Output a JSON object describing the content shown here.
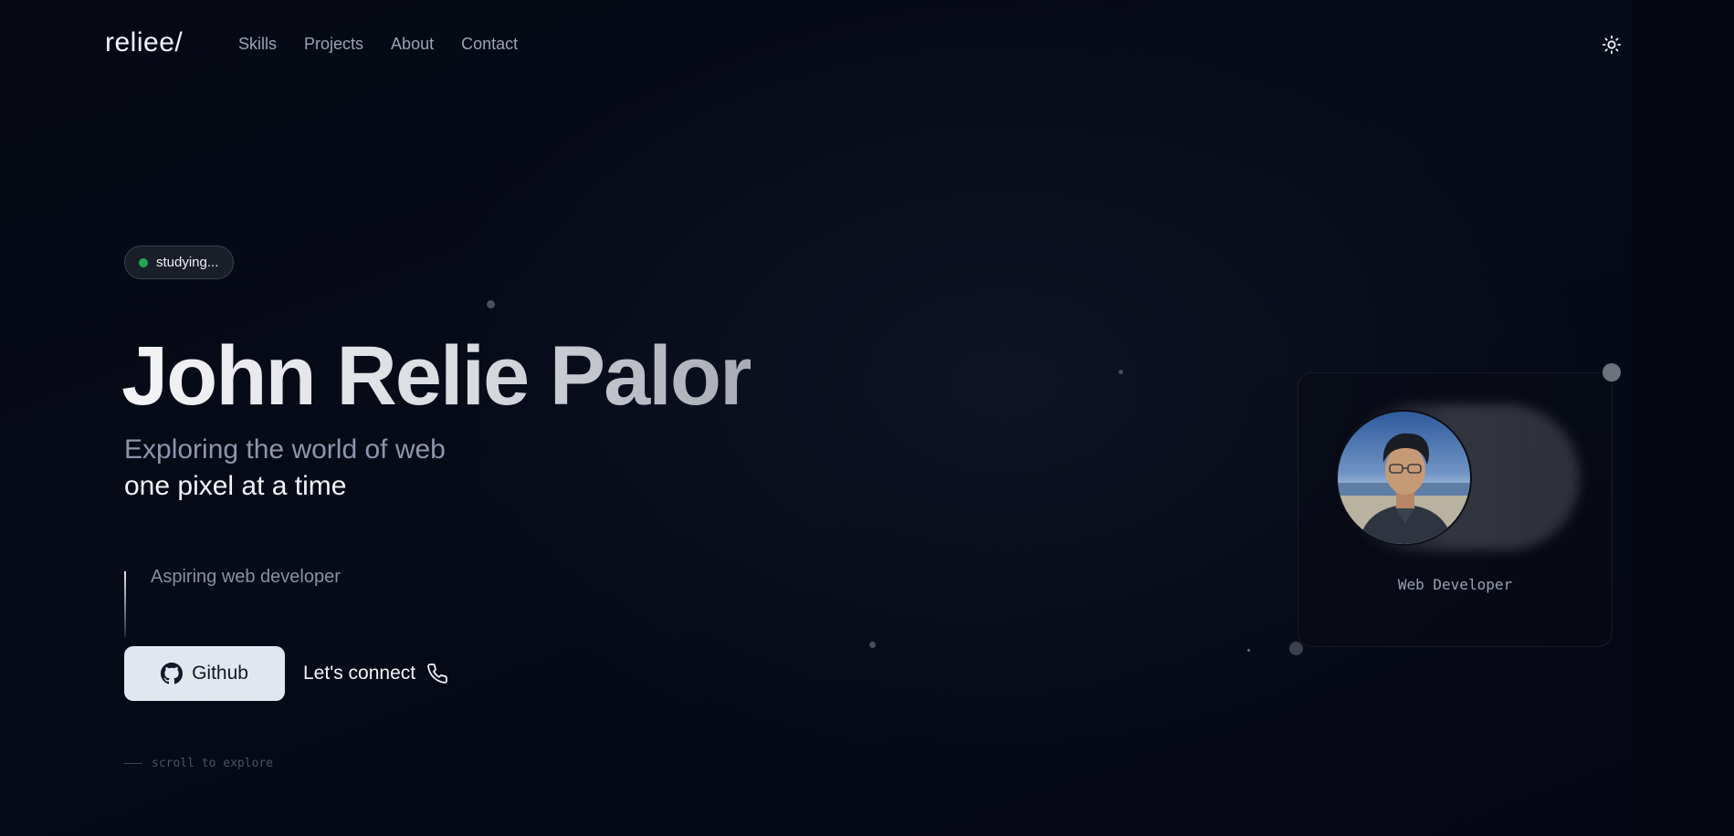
{
  "nav": {
    "logo": "reliee/",
    "links": [
      "Skills",
      "Projects",
      "About",
      "Contact"
    ],
    "theme_icon": "sun-icon"
  },
  "status": {
    "label": "studying...",
    "dot_color": "#22a84f"
  },
  "hero": {
    "title": "John Relie Palor",
    "subtitle_line1": "Exploring the world of web",
    "subtitle_line2": "one pixel at a time",
    "tagline": "Aspiring web developer"
  },
  "actions": {
    "github_label": "Github",
    "github_icon": "github-icon",
    "connect_label": "Let's connect",
    "connect_icon": "phone-icon"
  },
  "scroll_hint": "scroll to explore",
  "profile_card": {
    "role": "Web Developer"
  },
  "colors": {
    "background": "#050814",
    "accent_button": "#e2e6ee",
    "muted_text": "#8e96ac"
  }
}
